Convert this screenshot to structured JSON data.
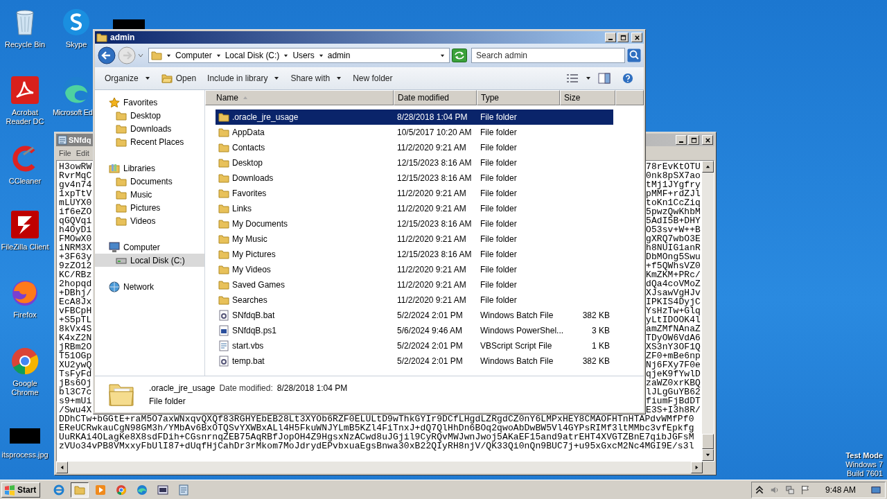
{
  "desktop_icons": [
    {
      "label": "Recycle Bin",
      "kind": "recyclebin"
    },
    {
      "label": "Skype",
      "kind": "skype"
    },
    {
      "label": "Acrobat Reader DC",
      "kind": "acrobat"
    },
    {
      "label": "Microsoft Ed",
      "kind": "edge"
    },
    {
      "label": "CCleaner",
      "kind": "ccleaner"
    },
    {
      "label": "FileZilla Client",
      "kind": "filezilla"
    },
    {
      "label": "Firefox",
      "kind": "firefox"
    },
    {
      "label": "Google Chrome",
      "kind": "chrome"
    },
    {
      "label": "itsprocess.jpg",
      "kind": "image"
    }
  ],
  "notepad": {
    "title": "SNfdq",
    "menu": [
      "File",
      "Edit"
    ],
    "partial_lines": [
      {
        "start": "H3owRW",
        "end": "78rEvKtOTU"
      },
      {
        "start": "RvrMqC",
        "end": "0nk8pSX7ao"
      },
      {
        "start": "gv4n74",
        "end": "tMj1JYgfry"
      },
      {
        "start": "1xpTtV",
        "end": "pMMF+rdZJl"
      },
      {
        "start": "mLUYX0",
        "end": "toKn1CcZiq"
      },
      {
        "start": "if6eZO",
        "end": "5pwzQwKhbM"
      },
      {
        "start": "qGQVqi",
        "end": "5AdI5B+DHY"
      },
      {
        "start": "h4OyDi",
        "end": "O53sv+W++B"
      },
      {
        "start": "FMOwX0",
        "end": "gXRQ7wbO3E"
      },
      {
        "start": "iNRM3X",
        "end": "h8NUIG1anR"
      },
      {
        "start": "+3F63y",
        "end": "DbMOng5Swu"
      },
      {
        "start": "9zZO12",
        "end": "+f5QWhsVZ0"
      },
      {
        "start": "KC/RBz",
        "end": "KmZKM+PRc/"
      },
      {
        "start": "2hopqd",
        "end": "dQa4coVMoZ"
      },
      {
        "start": "+DBhj/",
        "end": "XJsawVgHJv"
      },
      {
        "start": "EcA8Jx",
        "end": "IPKIS4DyjC"
      },
      {
        "start": "vFBCpH",
        "end": "YsHzTw+Glq"
      },
      {
        "start": "+S5pTL",
        "end": "yLtIDOOK4l"
      },
      {
        "start": "8kVx4S",
        "end": "amZMfNAnaZ"
      },
      {
        "start": "K4xZ2N",
        "end": "TDyOW6VdA6"
      },
      {
        "start": "jRBm2O",
        "end": "XS3nY3OF1Q"
      },
      {
        "start": "T51OGp",
        "end": "ZF0+mBe6np"
      },
      {
        "start": "XU2ywQ",
        "end": "Nj6FXy7F0e"
      },
      {
        "start": "TsFyFd",
        "end": "qjeK9fYwlD"
      },
      {
        "start": "jBs6Oj",
        "end": "zaWZ0xrKBQ"
      },
      {
        "start": "bl3C7c",
        "end": "lJLgGuYB62"
      },
      {
        "start": "s9+mUi",
        "end": "fiumFjBdDT"
      },
      {
        "start": "/Swu4X",
        "end": "E3S+I3h8R/"
      }
    ],
    "lines": [
      "DDhCTw+bGGtE+raM5O7axWNxqvQXQf83RGHYEbEB28Lt3XYOb6RZF0ELULtD9wThkGYIr9DCfLHgdLZRgdCZ0nY6LMPxHEY8CMAOFHTnHTAPdvWMfPf0",
      "EReUCRwkauCgN98GM3h/YMbAv6BxOTQSvYXWBxALl4H5FkuWNJYLmB5KZl4FiTnxJ+dQ7QlHhDn6BOq2qwoAbDwBW5Vl4GYPsRIMf3ltMMbc3vfEpkfg",
      "UuRKAi4OLagKe8X8sdFDih+CGsnrnqZEB75AqRBfJopOH4Z9HgsxNzACwd8uJGjil9CyRQvMWJwnJwoj5AKaEF15and9atrEHT4XVGTZBnE7qibJGFsM",
      "zVUo34vPB8VMxxyFbUlI87+dUqfHjCahDr3rMkom7MoJdrydEPvbxuaEgsBnwa30xB22QIyRH8njV/QK33Qi0nQn9BUC7j+u95xGxcM2Nc4MGI9E/s3l"
    ]
  },
  "explorer": {
    "title": "admin",
    "breadcrumb": [
      "Computer",
      "Local Disk (C:)",
      "Users",
      "admin"
    ],
    "search": {
      "placeholder": "Search admin"
    },
    "toolbar": [
      {
        "label": "Organize",
        "kind": "menu"
      },
      {
        "label": "Open",
        "kind": "icon"
      },
      {
        "label": "Include in library",
        "kind": "menu"
      },
      {
        "label": "Share with",
        "kind": "menu"
      },
      {
        "label": "New folder",
        "kind": "plain"
      }
    ],
    "nav": [
      {
        "label": "Favorites",
        "selected": false,
        "children": [
          {
            "label": "Desktop",
            "selected": false
          },
          {
            "label": "Downloads",
            "selected": false
          },
          {
            "label": "Recent Places",
            "selected": false
          }
        ]
      },
      {
        "label": "Libraries",
        "selected": false,
        "children": [
          {
            "label": "Documents",
            "selected": false
          },
          {
            "label": "Music",
            "selected": false
          },
          {
            "label": "Pictures",
            "selected": false
          },
          {
            "label": "Videos",
            "selected": false
          }
        ]
      },
      {
        "label": "Computer",
        "selected": false,
        "children": [
          {
            "label": "Local Disk (C:)",
            "selected": true
          }
        ]
      },
      {
        "label": "Network",
        "selected": false
      }
    ],
    "columns": [
      {
        "label": "Name",
        "sorted": true
      },
      {
        "label": "Date modified",
        "sorted": false
      },
      {
        "label": "Type",
        "sorted": false
      },
      {
        "label": "Size",
        "sorted": false
      }
    ],
    "rows": [
      {
        "name": ".oracle_jre_usage",
        "date": "8/28/2018 1:04 PM",
        "type": "File folder",
        "kind": "folder",
        "selected": true
      },
      {
        "name": "AppData",
        "date": "10/5/2017 10:20 AM",
        "type": "File folder",
        "kind": "folder",
        "selected": false
      },
      {
        "name": "Contacts",
        "date": "11/2/2020 9:21 AM",
        "type": "File folder",
        "kind": "folder",
        "selected": false
      },
      {
        "name": "Desktop",
        "date": "12/15/2023 8:16 AM",
        "type": "File folder",
        "kind": "folder",
        "selected": false
      },
      {
        "name": "Downloads",
        "date": "12/15/2023 8:16 AM",
        "type": "File folder",
        "kind": "folder",
        "selected": false
      },
      {
        "name": "Favorites",
        "date": "11/2/2020 9:21 AM",
        "type": "File folder",
        "kind": "folder",
        "selected": false
      },
      {
        "name": "Links",
        "date": "11/2/2020 9:21 AM",
        "type": "File folder",
        "kind": "folder",
        "selected": false
      },
      {
        "name": "My Documents",
        "date": "12/15/2023 8:16 AM",
        "type": "File folder",
        "kind": "folder",
        "selected": false
      },
      {
        "name": "My Music",
        "date": "11/2/2020 9:21 AM",
        "type": "File folder",
        "kind": "folder",
        "selected": false
      },
      {
        "name": "My Pictures",
        "date": "12/15/2023 8:16 AM",
        "type": "File folder",
        "kind": "folder",
        "selected": false
      },
      {
        "name": "My Videos",
        "date": "11/2/2020 9:21 AM",
        "type": "File folder",
        "kind": "folder",
        "selected": false
      },
      {
        "name": "Saved Games",
        "date": "11/2/2020 9:21 AM",
        "type": "File folder",
        "kind": "folder",
        "selected": false
      },
      {
        "name": "Searches",
        "date": "11/2/2020 9:21 AM",
        "type": "File folder",
        "kind": "folder",
        "selected": false
      },
      {
        "name": "SNfdqB.bat",
        "date": "5/2/2024 2:01 PM",
        "type": "Windows Batch File",
        "size": "382 KB",
        "kind": "batch",
        "selected": false
      },
      {
        "name": "SNfdqB.ps1",
        "date": "5/6/2024 9:46 AM",
        "type": "Windows PowerShel...",
        "size": "3 KB",
        "kind": "powershell",
        "selected": false
      },
      {
        "name": "start.vbs",
        "date": "5/2/2024 2:01 PM",
        "type": "VBScript Script File",
        "size": "1 KB",
        "kind": "script",
        "selected": false
      },
      {
        "name": "temp.bat",
        "date": "5/2/2024 2:01 PM",
        "type": "Windows Batch File",
        "size": "382 KB",
        "kind": "batch",
        "selected": false
      }
    ],
    "details": {
      "name": ".oracle_jre_usage",
      "date_label": "Date modified:",
      "date": "8/28/2018 1:04 PM",
      "type": "File folder"
    }
  },
  "taskbar": {
    "start": "Start",
    "items": [
      {
        "kind": "ie",
        "selected": false
      },
      {
        "kind": "explorer",
        "selected": true
      },
      {
        "kind": "media",
        "selected": false
      },
      {
        "kind": "chrome",
        "selected": false
      },
      {
        "kind": "edge",
        "selected": false
      },
      {
        "kind": "app",
        "selected": false
      },
      {
        "kind": "notepad",
        "selected": false
      }
    ],
    "clock": "9:48 AM"
  },
  "desktop_notice": [
    "Test Mode",
    "Windows 7",
    "Build 7601"
  ]
}
